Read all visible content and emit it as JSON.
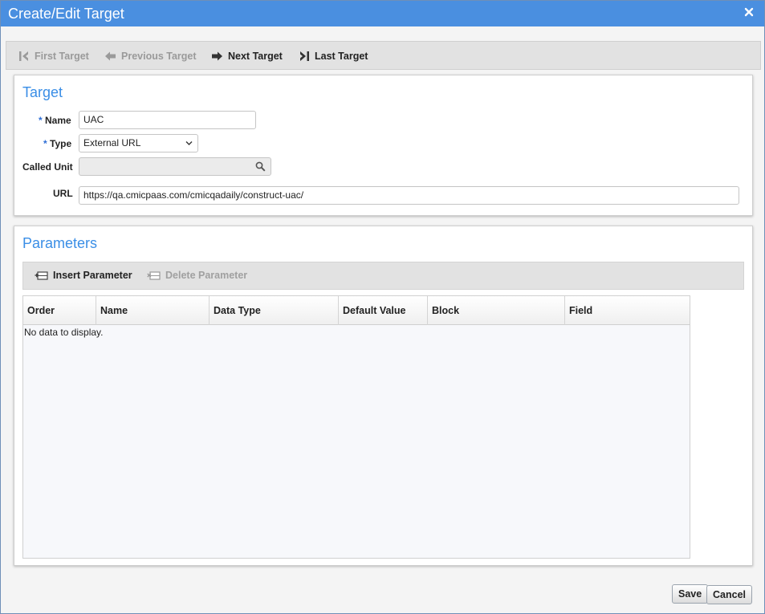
{
  "dialog": {
    "title": "Create/Edit Target"
  },
  "nav": {
    "first": "First Target",
    "previous": "Previous Target",
    "next": "Next Target",
    "last": "Last Target"
  },
  "target_section": {
    "title": "Target",
    "required_marker": "*",
    "name_label": "Name",
    "name_value": "UAC",
    "type_label": "Type",
    "type_value": "External URL",
    "called_unit_label": "Called Unit",
    "called_unit_value": "",
    "url_label": "URL",
    "url_value": "https://qa.cmicpaas.com/cmicqadaily/construct-uac/"
  },
  "parameters_section": {
    "title": "Parameters",
    "insert_label": "Insert Parameter",
    "delete_label": "Delete Parameter",
    "columns": [
      "Order",
      "Name",
      "Data Type",
      "Default Value",
      "Block",
      "Field"
    ],
    "empty_text": "No data to display."
  },
  "footer": {
    "save": "Save",
    "cancel": "Cancel"
  },
  "icons": {
    "close": "close-icon",
    "first": "first-icon",
    "previous": "arrow-left-icon",
    "next": "arrow-right-icon",
    "last": "last-icon",
    "search": "search-icon",
    "dropdown": "chevron-down-icon",
    "insert": "insert-row-icon",
    "delete": "delete-row-icon"
  },
  "colors": {
    "titlebar": "#4a8fe0",
    "section_title": "#3a8ee6",
    "required": "#2f6fd6"
  }
}
